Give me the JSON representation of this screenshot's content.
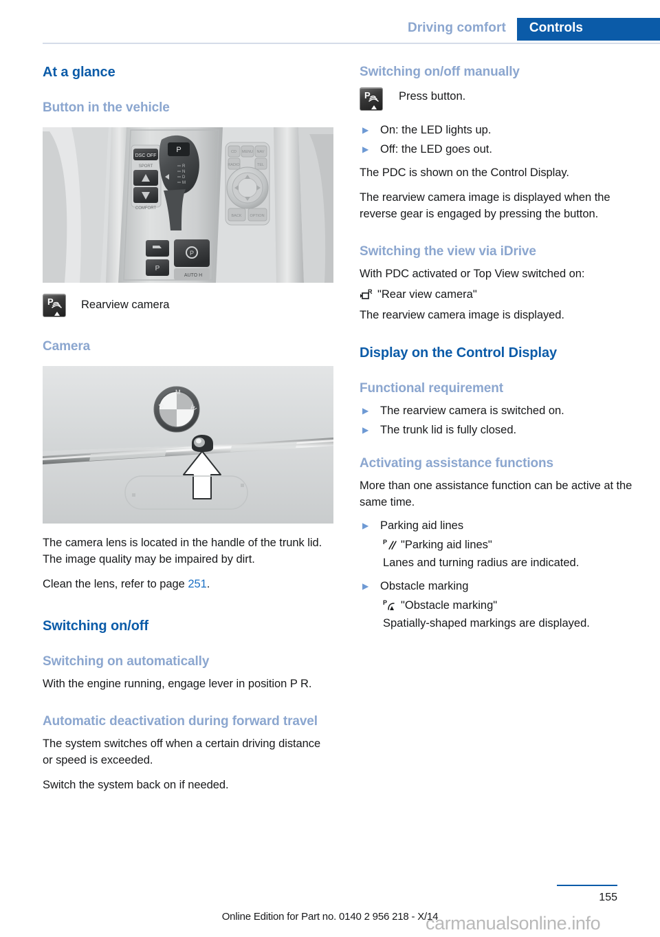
{
  "header": {
    "chapter": "Driving comfort",
    "section": "Controls",
    "accent": "#0b5ba8",
    "muted_accent": "#8ba6cf"
  },
  "left_column": {
    "h1_at_a_glance": "At a glance",
    "h2_button_in_vehicle": "Button in the vehicle",
    "figure_console_alt": "Center console with gear selector and PDC button",
    "icon_rearview_label": "Rearview camera",
    "h2_camera": "Camera",
    "figure_trunk_alt": "Trunk lid handle with rearview camera lens and arrow",
    "p_lens_location": "The camera lens is located in the handle of the trunk lid. The image quality may be impaired by dirt.",
    "p_clean_prefix": "Clean the lens, refer to page ",
    "p_clean_pagenum": "251",
    "p_clean_suffix": ".",
    "h1_switching_on_off": "Switching on/off",
    "h2_switching_on_automatically": "Switching on automatically",
    "p_engine_running": "With the engine running, engage lever in position P R.",
    "h2_automatic_deactivation": "Automatic deactivation during forward travel",
    "p_system_switches_off": "The system switches off when a certain driving distance or speed is exceeded.",
    "p_switch_back_on": "Switch the system back on if needed."
  },
  "right_column": {
    "h2_switching_manually": "Switching on/off manually",
    "press_button": "Press button.",
    "bullets_led": [
      "On: the LED lights up.",
      "Off: the LED goes out."
    ],
    "p_pdc_shown": "The PDC is shown on the Control Display.",
    "p_rearview_displayed": "The rearview camera image is displayed when the reverse gear is engaged by pressing the button.",
    "h2_switching_view_idrive": "Switching the view via iDrive",
    "p_with_pdc_activated": "With PDC activated or Top View switched on:",
    "menu_rear_view_camera": "\"Rear view camera\"",
    "p_rearview_is_displayed": "The rearview camera image is displayed.",
    "h1_display_on_control_display": "Display on the Control Display",
    "h2_functional_requirement": "Functional requirement",
    "bullets_requirements": [
      "The rearview camera is switched on.",
      "The trunk lid is fully closed."
    ],
    "h2_activating_assistance": "Activating assistance functions",
    "p_more_than_one": "More than one assistance function can be active at the same time.",
    "assistance": [
      {
        "bullet": "Parking aid lines",
        "menu": "\"Parking aid lines\"",
        "description": "Lanes and turning radius are indicated."
      },
      {
        "bullet": "Obstacle marking",
        "menu": "\"Obstacle marking\"",
        "description": "Spatially-shaped markings are displayed."
      }
    ]
  },
  "footer": {
    "edition": "Online Edition for Part no. 0140 2 956 218 - X/14",
    "page_number": "155",
    "watermark": "carmanualsonline.info"
  },
  "icons": {
    "pdc_button": "pdc-rearview-camera-icon",
    "rear_view_camera_menu": "rear-view-camera-menu-icon",
    "parking_aid_lines_menu": "parking-aid-lines-menu-icon",
    "obstacle_marking_menu": "obstacle-marking-menu-icon",
    "bullet_marker": "triangle-right-bullet-icon"
  }
}
